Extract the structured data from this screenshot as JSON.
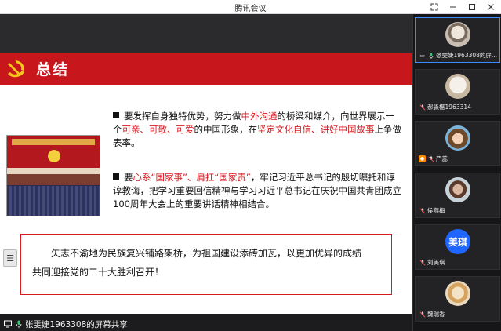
{
  "window": {
    "title": "腾讯会议"
  },
  "slide": {
    "title": "总结",
    "bullet1": {
      "p1": "要发挥自身独特优势，努力做",
      "h1": "中外沟通",
      "p2": "的桥梁和媒介，向世界展示一个",
      "h2": "可亲、可敬、可爱",
      "p3": "的中国形象，在",
      "h3": "坚定文化自信、讲好中国故事",
      "p4": "上争做表率。"
    },
    "bullet2": {
      "p1": "要",
      "h1": "心系“国家事”、肩扛“国家责”",
      "p2": "，牢记习近平总书记的殷切嘱托和谆谆教诲，把学习重要回信精神与学习习近平总书记在庆祝中国共青团成立100周年大会上的重要讲话精神相结合。"
    },
    "slogan": {
      "line1": "矢志不渝地为民族复兴铺路架桥，为祖国建设添砖加瓦，以更加优异的成绩",
      "line2": "共同迎接党的二十大胜利召开！"
    }
  },
  "share": {
    "label": "张雯婕1963308的屏幕共享"
  },
  "participants": [
    {
      "name": "张雯婕1963308的屏...",
      "avatar_icon": "cat-photo"
    },
    {
      "name": "郝淼椹1963314",
      "avatar_icon": "white-dog-photo"
    },
    {
      "name": "严蕊",
      "avatar_icon": "anime-girl-photo"
    },
    {
      "name": "侯燕梅",
      "avatar_icon": "person-photo"
    },
    {
      "name": "刘美琪",
      "avatar_text": "美琪"
    },
    {
      "name": "魏瑞香",
      "avatar_icon": "puppy-photo"
    }
  ],
  "colors": {
    "header_red": "#c8161d",
    "text_red": "#d71920",
    "active_border": "#3a8bff",
    "avatar_blue": "#1e66ff"
  }
}
